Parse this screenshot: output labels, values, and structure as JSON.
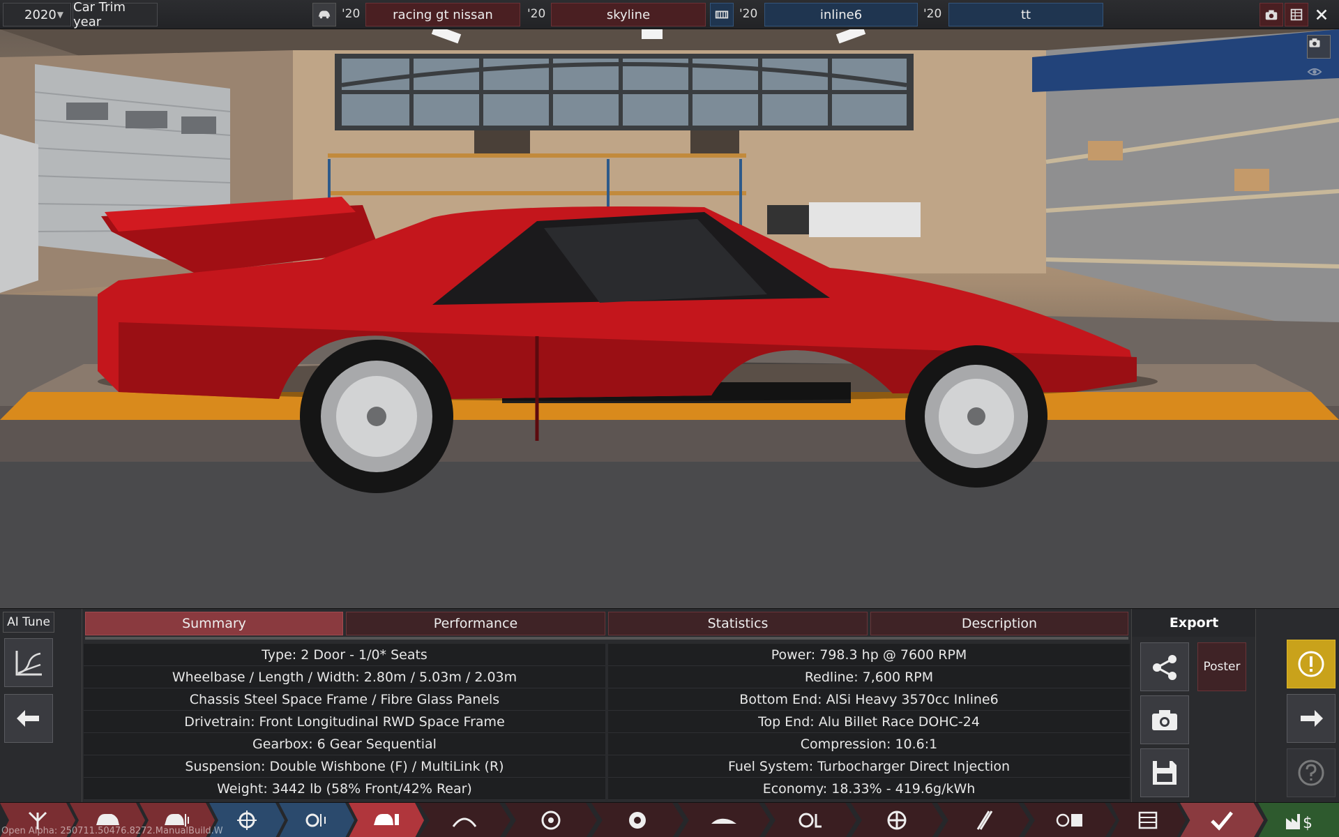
{
  "topbar": {
    "year_select": "2020",
    "trim_year_label": "Car Trim year",
    "model_year": "'20",
    "model_name": "racing gt nissan",
    "trim_year": "'20",
    "trim_name": "skyline",
    "engine_family_year": "'20",
    "engine_family_name": "inline6",
    "engine_variant_year": "'20",
    "engine_variant_name": "tt"
  },
  "panel": {
    "ai_tune_label": "AI Tune",
    "tabs": [
      {
        "label": "Summary",
        "active": true
      },
      {
        "label": "Performance",
        "active": false
      },
      {
        "label": "Statistics",
        "active": false
      },
      {
        "label": "Description",
        "active": false
      }
    ],
    "summary_left": [
      "Type: 2 Door - 1/0* Seats",
      "Wheelbase / Length / Width: 2.80m / 5.03m / 2.03m",
      "Chassis Steel Space Frame / Fibre Glass Panels",
      "Drivetrain: Front Longitudinal RWD Space Frame",
      "Gearbox: 6 Gear Sequential",
      "Suspension: Double Wishbone (F) / MultiLink (R)",
      "Weight: 3442 lb (58% Front/42% Rear)"
    ],
    "summary_right": [
      "Power: 798.3 hp @ 7600 RPM",
      "Redline:  7,600 RPM",
      "Bottom End: AlSi Heavy 3570cc Inline6",
      "Top End: Alu Billet Race DOHC-24",
      "Compression: 10.6:1",
      "Fuel System: Turbocharger Direct Injection",
      "Economy: 18.33% - 419.6g/kWh"
    ],
    "export_title": "Export",
    "poster_label": "Poster"
  },
  "footer": {
    "version": "Open Alpha: 250711.50476.8272.ManualBuild.W"
  },
  "colors": {
    "active_tab": "#8a3a3f",
    "tab": "#3f2326",
    "blue_field": "#1f3550",
    "warning": "#c9a21b",
    "car_red": "#c4161c"
  },
  "nav": [
    {
      "icon": "family-tree-icon",
      "color": "#7a2e32"
    },
    {
      "icon": "car-model-icon",
      "color": "#7a2e32"
    },
    {
      "icon": "car-trim-icon",
      "color": "#7a2e32"
    },
    {
      "icon": "engine-family-icon",
      "color": "#2b4a6d"
    },
    {
      "icon": "engine-variant-icon",
      "color": "#2b4a6d"
    },
    {
      "icon": "car-design-icon",
      "color": "#b0363c"
    },
    {
      "icon": "engine-bay-icon",
      "color": "#3a1e21"
    },
    {
      "icon": "wheel-icon",
      "color": "#3a1e21"
    },
    {
      "icon": "brakes-icon",
      "color": "#3a1e21"
    },
    {
      "icon": "aero-icon",
      "color": "#3a1e21"
    },
    {
      "icon": "interior-icon",
      "color": "#3a1e21"
    },
    {
      "icon": "suspension-icon",
      "color": "#3a1e21"
    },
    {
      "icon": "tuning-icon",
      "color": "#3a1e21"
    },
    {
      "icon": "test-track-icon",
      "color": "#3a1e21"
    },
    {
      "icon": "spreadsheet-icon",
      "color": "#3a1e21"
    },
    {
      "icon": "confirm-check-icon",
      "color": "#8a3a3f"
    },
    {
      "icon": "factory-money-icon",
      "color": "#2e5a2e"
    }
  ]
}
